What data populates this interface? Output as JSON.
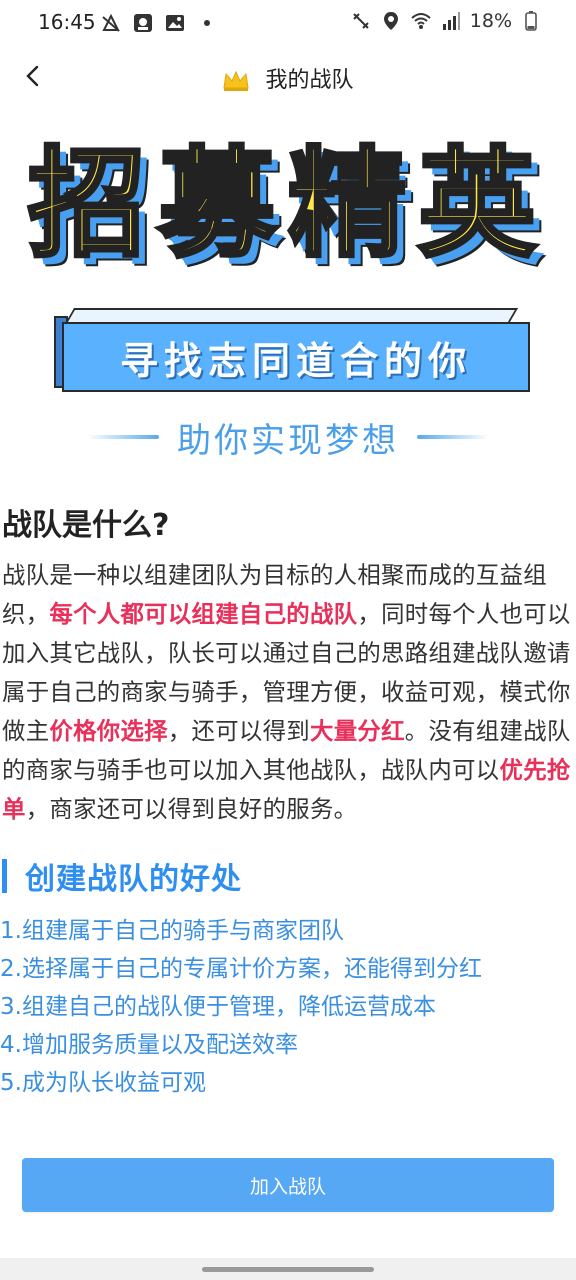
{
  "status_bar": {
    "time": "16:45",
    "battery": "18%",
    "left_icons": [
      "notification-mute-icon",
      "app-icon",
      "image-icon",
      "dot-icon"
    ],
    "right_icons": [
      "vibrate-icon",
      "location-icon",
      "wifi-icon",
      "signal-icon",
      "battery-icon"
    ]
  },
  "header": {
    "back_icon": "back-chevron-icon",
    "title": "我的战队",
    "title_icon": "crown-icon"
  },
  "hero": {
    "headline": "招募精英",
    "banner": "寻找志同道合的你",
    "slogan": "助你实现梦想"
  },
  "intro": {
    "title": "战队是什么?",
    "p1": "战队是一种以组建团队为目标的人相聚而成的互益组织，",
    "h1": "每个人都可以组建自己的战队",
    "p2": "，同时每个人也可以加入其它战队，队长可以通过自己的思路组建战队邀请属于自己的商家与骑手，管理方便，收益可观，模式你做主",
    "h2": "价格你选择",
    "p3": "，还可以得到",
    "h3": "大量分红",
    "p4": "。没有组建战队的商家与骑手也可以加入其他战队，战队内可以",
    "h4": "优先抢单",
    "p5": "，商家还可以得到良好的服务。"
  },
  "benefits": {
    "title": "创建战队的好处",
    "items": [
      "1.组建属于自己的骑手与商家团队",
      "2.选择属于自己的专属计价方案，还能得到分红",
      "3.组建自己的战队便于管理，降低运营成本",
      "4.增加服务质量以及配送效率",
      "5.成为队长收益可观"
    ]
  },
  "actions": {
    "join_label": "加入战队"
  },
  "colors": {
    "accent": "#56a7f4",
    "highlight": "#e8305a",
    "headline_fill": "#ffe94a",
    "benefit_text": "#3a8fe0"
  }
}
